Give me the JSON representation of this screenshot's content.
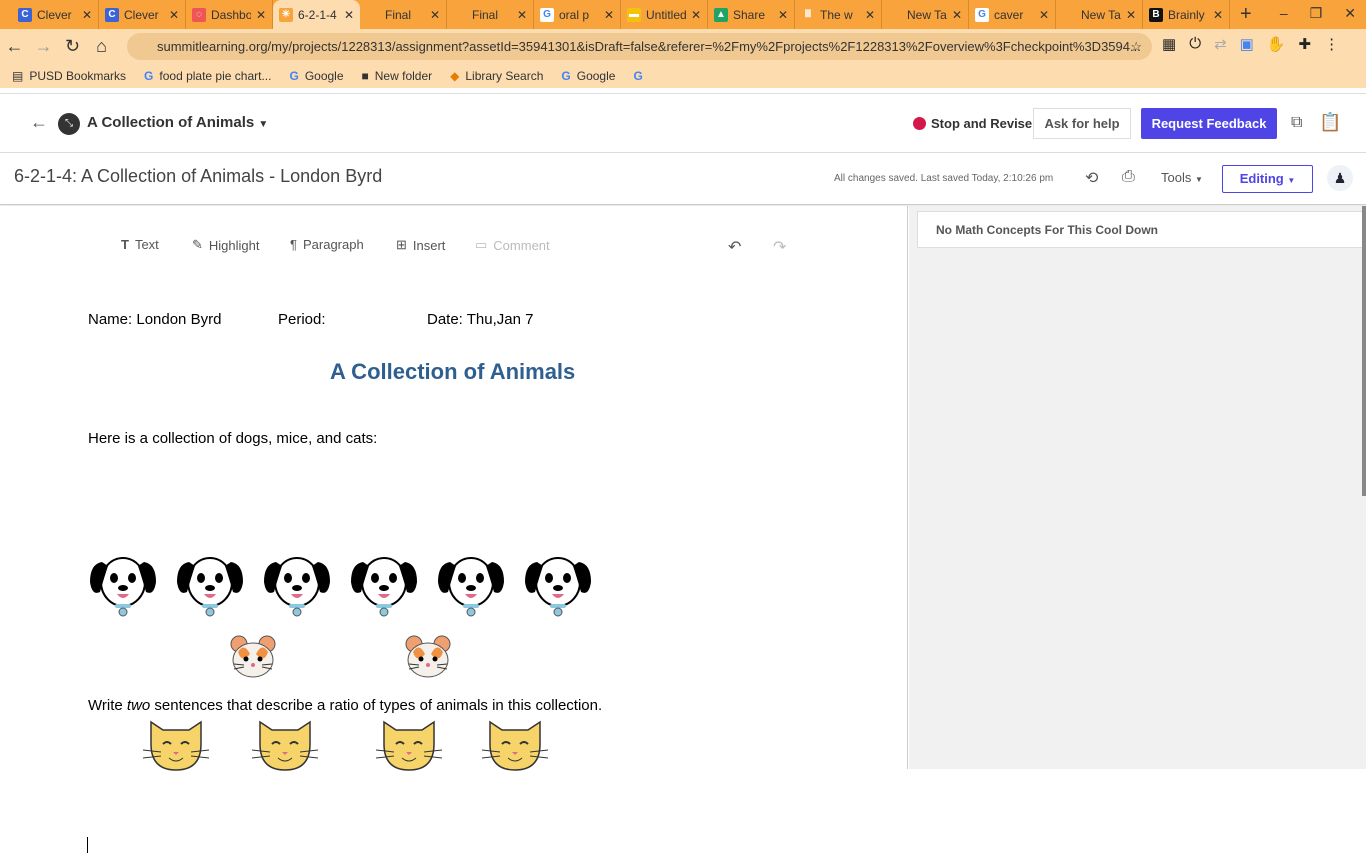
{
  "browser": {
    "tabs": [
      {
        "label": "Clever",
        "icon": "C",
        "color": "#3b63d8"
      },
      {
        "label": "Clever",
        "icon": "C",
        "color": "#3b63d8"
      },
      {
        "label": "Dashboard",
        "icon": "◌",
        "color": "#e55"
      },
      {
        "label": "6-2-1-4",
        "icon": "✳",
        "color": "#f9a33c",
        "active": true
      },
      {
        "label": "Final",
        "icon": "",
        "color": "transparent"
      },
      {
        "label": "Final",
        "icon": "",
        "color": "transparent"
      },
      {
        "label": "oral p",
        "icon": "G",
        "color": "#fff"
      },
      {
        "label": "Untitled",
        "icon": "▬",
        "color": "#f4c20d"
      },
      {
        "label": "Share",
        "icon": "▲",
        "color": "#1fa463"
      },
      {
        "label": "The w",
        "icon": "Ⅲ",
        "color": "transparent"
      },
      {
        "label": "New Tab",
        "icon": "",
        "color": "transparent"
      },
      {
        "label": "caver",
        "icon": "G",
        "color": "#fff"
      },
      {
        "label": "New Tab",
        "icon": "",
        "color": "transparent"
      },
      {
        "label": "Brainly",
        "icon": "B",
        "color": "#111"
      }
    ],
    "url": "summitlearning.org/my/projects/1228313/assignment?assetId=35941301&isDraft=false&referer=%2Fmy%2Fprojects%2F1228313%2Foverview%3Fcheckpoint%3D3594...",
    "bookmarks": [
      "PUSD Bookmarks",
      "food plate pie chart...",
      "Google",
      "New folder",
      "Library Search",
      "Google"
    ]
  },
  "header": {
    "project_title": "A Collection of Animals",
    "status": "Stop and Revise",
    "status_color": "#d3194a",
    "ask_help": "Ask for help",
    "request_feedback": "Request Feedback"
  },
  "subheader": {
    "doc_title": "6-2-1-4: A Collection of Animals  - London Byrd",
    "saved": "All changes saved. Last saved Today, 2:10:26 pm",
    "tools": "Tools",
    "editing": "Editing"
  },
  "editor_toolbar": {
    "text": "Text",
    "highlight": "Highlight",
    "paragraph": "Paragraph",
    "insert": "Insert",
    "comment": "Comment"
  },
  "document": {
    "name": "Name: London Byrd",
    "period": "Period:",
    "date": "Date: Thu,Jan 7",
    "heading": "A Collection of Animals",
    "intro": "Here is a collection of dogs, mice, and cats:",
    "dogs": 6,
    "mice": 2,
    "cats": 4,
    "prompt_pre": "Write ",
    "prompt_em": "two",
    "prompt_post": " sentences that describe a ratio of types of animals in this collection."
  },
  "side_panel": {
    "card": "No Math Concepts For This Cool Down"
  }
}
